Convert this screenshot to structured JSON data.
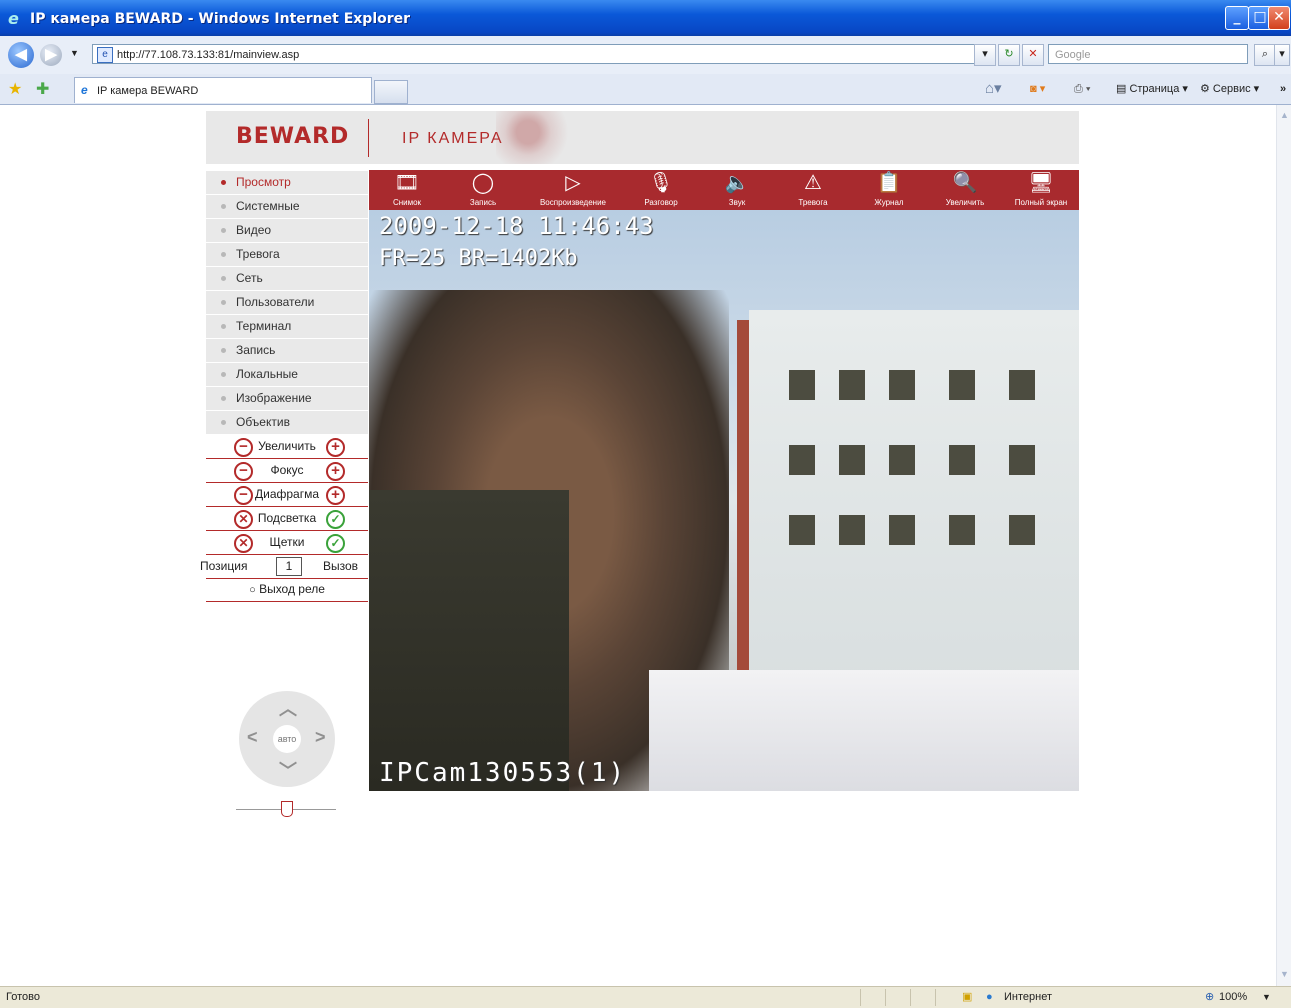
{
  "window": {
    "title": "IP камера BEWARD - Windows Internet Explorer"
  },
  "address": {
    "url": "http://77.108.73.133:81/mainview.asp",
    "search_placeholder": "Google"
  },
  "tab": {
    "label": "IP камера BEWARD"
  },
  "commandbar": {
    "page": "Страница",
    "tools": "Сервис"
  },
  "header": {
    "logo": "BEWARD",
    "subtitle": "IP КАМЕРА"
  },
  "menu": {
    "items": [
      {
        "label": "Просмотр",
        "active": true
      },
      {
        "label": "Системные"
      },
      {
        "label": "Видео"
      },
      {
        "label": "Тревога"
      },
      {
        "label": "Сеть"
      },
      {
        "label": "Пользователи"
      },
      {
        "label": "Терминал"
      },
      {
        "label": "Запись"
      },
      {
        "label": "Локальные"
      },
      {
        "label": "Изображение"
      },
      {
        "label": "Объектив"
      }
    ]
  },
  "lens": {
    "zoom": "Увеличить",
    "focus": "Фокус",
    "iris": "Диафрагма",
    "backlight": "Подсветка",
    "wiper": "Щетки"
  },
  "position": {
    "label": "Позиция",
    "value": "1",
    "call": "Вызов"
  },
  "relay": {
    "label": "Выход реле"
  },
  "ptz": {
    "auto": "авто"
  },
  "toolbar": {
    "snapshot": "Снимок",
    "record": "Запись",
    "playback": "Воспроизведение",
    "talk": "Разговор",
    "sound": "Звук",
    "alarm": "Тревога",
    "log": "Журнал",
    "zoom": "Увеличить",
    "fullscreen": "Полный экран"
  },
  "video": {
    "timestamp": "2009-12-18 11:46:43",
    "stats": "FR=25 BR=1402Kb",
    "camera_id": "IPCam130553(1)"
  },
  "status": {
    "left": "Готово",
    "zone": "Интернет",
    "zoom": "100%"
  },
  "colors": {
    "brand": "#b32a2a",
    "toolbar": "#a82a2e"
  }
}
